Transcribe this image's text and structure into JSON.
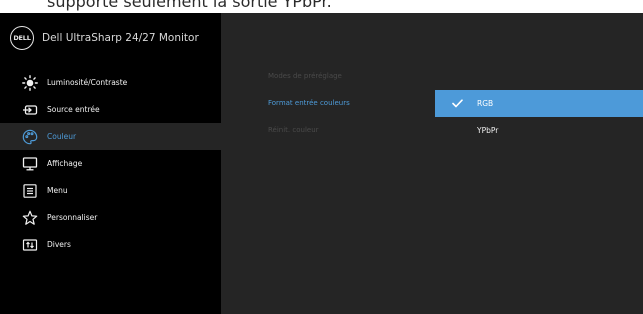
{
  "caption": "supporte seulement la sortie YPbPr.",
  "brand": {
    "logo": "DELL",
    "title": "Dell UltraSharp 24/27 Monitor"
  },
  "menu": [
    {
      "label": "Luminosité/Contraste",
      "icon": "brightness-icon",
      "active": false
    },
    {
      "label": "Source entrée",
      "icon": "input-source-icon",
      "active": false
    },
    {
      "label": "Couleur",
      "icon": "color-palette-icon",
      "active": true
    },
    {
      "label": "Affichage",
      "icon": "display-icon",
      "active": false
    },
    {
      "label": "Menu",
      "icon": "menu-icon",
      "active": false
    },
    {
      "label": "Personnaliser",
      "icon": "star-icon",
      "active": false
    },
    {
      "label": "Divers",
      "icon": "others-icon",
      "active": false
    }
  ],
  "submenu": [
    {
      "label": "Modes de préréglage",
      "state": "disabled"
    },
    {
      "label": "Format entrée couleurs",
      "state": "active"
    },
    {
      "label": "Réinit. couleur",
      "state": "disabled"
    }
  ],
  "options": [
    {
      "label": "RGB",
      "selected": true
    },
    {
      "label": "YPbPr",
      "selected": false
    }
  ],
  "colors": {
    "accent": "#4d9ad9",
    "sidebar_bg": "#000000",
    "content_bg": "#252525",
    "active_menu_bg": "#252525",
    "disabled_text": "#4a4a4a"
  }
}
